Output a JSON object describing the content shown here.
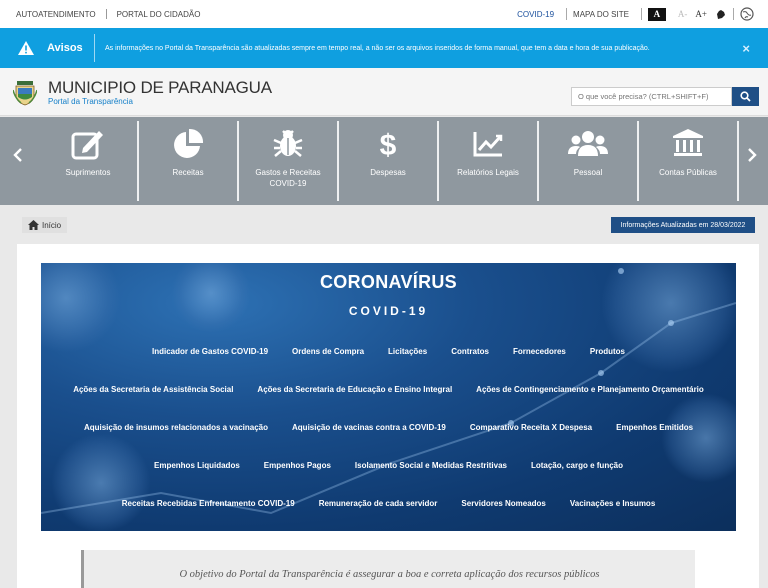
{
  "topbar": {
    "left_links": [
      "AUTOATENDIMENTO",
      "PORTAL DO CIDADÃO"
    ],
    "covid_link": "COVID-19",
    "map_link": "MAPA DO SITE",
    "contrast_label": "A",
    "font_decrease": "A-",
    "font_increase": "A+"
  },
  "notice": {
    "title": "Avisos",
    "message": "As informações no Portal da Transparência são atualizadas sempre em tempo real, a não ser os arquivos inseridos de forma manual, que tem a data e hora de sua publicação.",
    "close": "×"
  },
  "header": {
    "title": "MUNICIPIO DE PARANAGUA",
    "subtitle": "Portal da Transparência",
    "search_placeholder": "O que você precisa? (CTRL+SHIFT+F)"
  },
  "nav": {
    "items": [
      {
        "label": "Suprimentos",
        "icon": "edit-icon"
      },
      {
        "label": "Receitas",
        "icon": "pie-chart-icon"
      },
      {
        "label": "Gastos e Receitas\nCOVID-19",
        "icon": "virus-icon"
      },
      {
        "label": "Despesas",
        "icon": "dollar-icon"
      },
      {
        "label": "Relatórios Legais",
        "icon": "line-chart-icon"
      },
      {
        "label": "Pessoal",
        "icon": "users-icon"
      },
      {
        "label": "Contas Públicas",
        "icon": "institution-icon"
      }
    ]
  },
  "breadcrumb": {
    "home": "Início"
  },
  "updated_badge": "Informações Atualizadas em 28/03/2022",
  "banner": {
    "title": "CORONAVÍRUS",
    "subtitle": "COVID-19",
    "rows": [
      [
        "Indicador de Gastos COVID-19",
        "Ordens de Compra",
        "Licitações",
        "Contratos",
        "Fornecedores",
        "Produtos"
      ],
      [
        "Ações da Secretaria de Assistência Social",
        "Ações da Secretaria de Educação e Ensino Integral",
        "Ações de Contingenciamento e Planejamento Orçamentário"
      ],
      [
        "Aquisição de insumos relacionados a vacinação",
        "Aquisição de vacinas contra a COVID-19",
        "Comparativo Receita X Despesa",
        "Empenhos Emitidos"
      ],
      [
        "Empenhos Liquidados",
        "Empenhos Pagos",
        "Isolamento Social e Medidas Restritivas",
        "Lotação, cargo e função"
      ],
      [
        "Receitas Recebidas Enfrentamento COVID-19",
        "Remuneração de cada servidor",
        "Servidores Nomeados",
        "Vacinações e Insumos"
      ]
    ]
  },
  "quote": "O objetivo do Portal da Transparência é assegurar a boa e correta aplicação dos recursos públicos",
  "colors": {
    "notice_bg": "#0f9fe0",
    "nav_bg": "#8f989f",
    "brand_dark": "#1f4f86",
    "banner": "#1a4f8d"
  }
}
